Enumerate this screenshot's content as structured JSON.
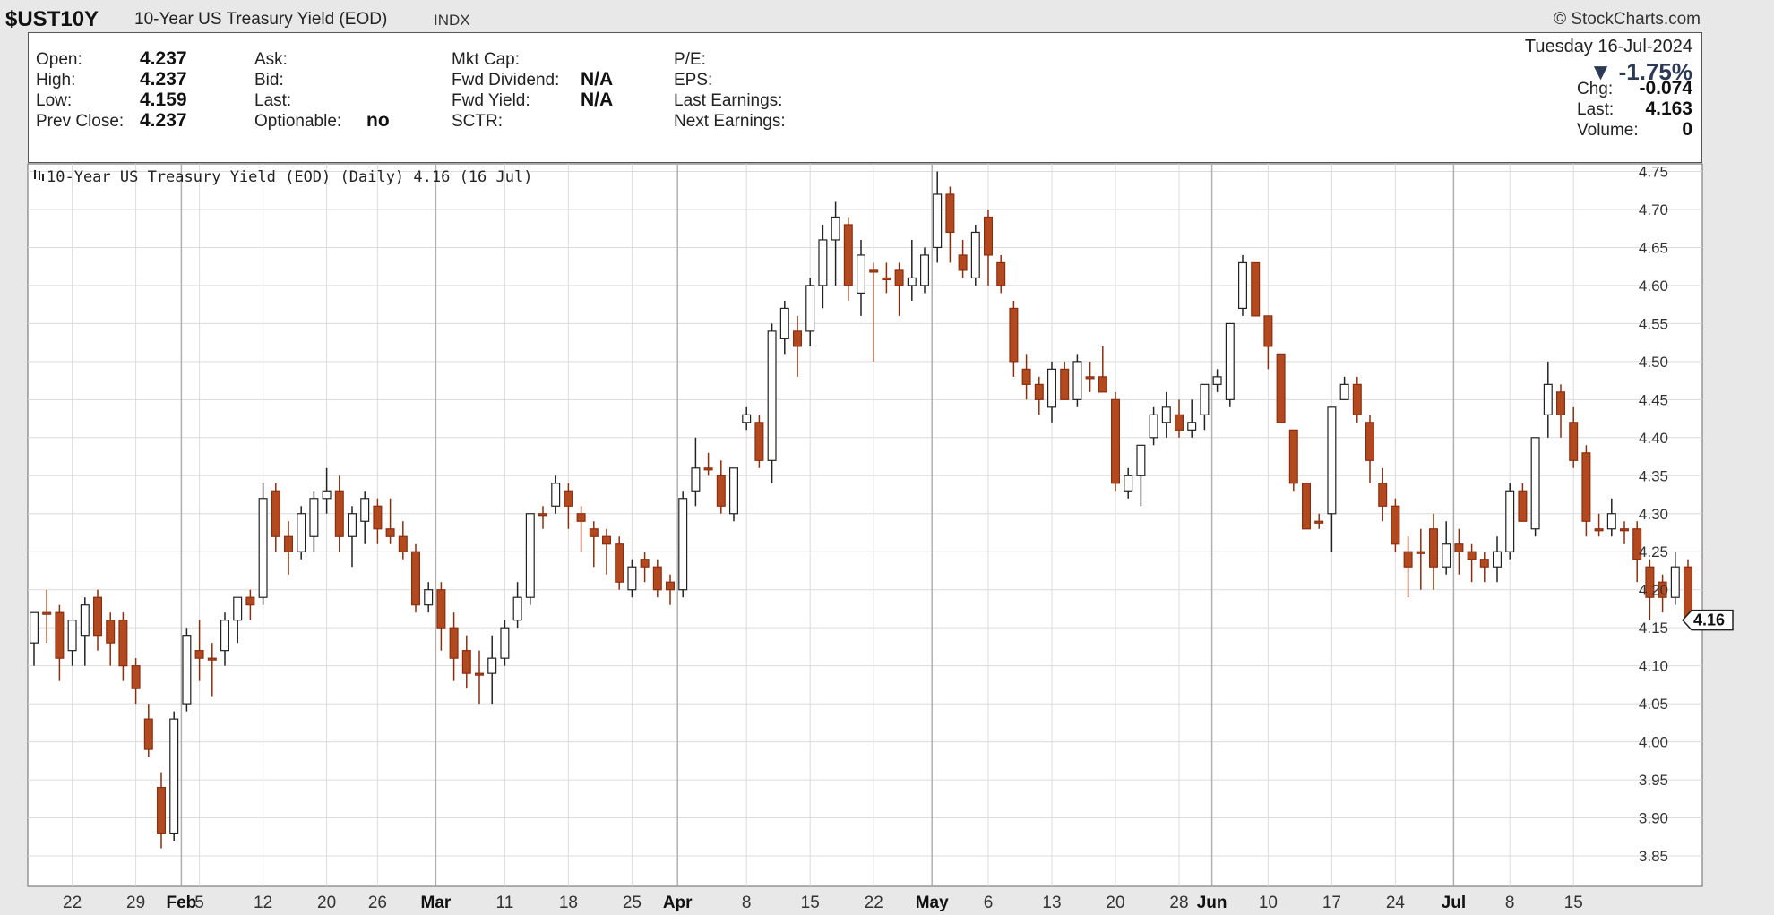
{
  "header": {
    "symbol": "$UST10Y",
    "name": "10-Year US Treasury Yield (EOD)",
    "index_tag": "INDX",
    "copyright": "© StockCharts.com"
  },
  "info": {
    "open_label": "Open:",
    "open": "4.237",
    "high_label": "High:",
    "high": "4.237",
    "low_label": "Low:",
    "low": "4.159",
    "prev_close_label": "Prev Close:",
    "prev_close": "4.237",
    "ask_label": "Ask:",
    "bid_label": "Bid:",
    "last_label": "Last:",
    "optionable_label": "Optionable:",
    "optionable": "no",
    "mkt_cap_label": "Mkt Cap:",
    "fwd_dividend_label": "Fwd Dividend:",
    "fwd_dividend": "N/A",
    "fwd_yield_label": "Fwd Yield:",
    "fwd_yield": "N/A",
    "sctr_label": "SCTR:",
    "pe_label": "P/E:",
    "eps_label": "EPS:",
    "last_earnings_label": "Last Earnings:",
    "next_earnings_label": "Next Earnings:",
    "date": "Tuesday  16-Jul-2024",
    "change_pct": "▼ -1.75%",
    "chg_label": "Chg:",
    "chg": "-0.074",
    "last_price_label": "Last:",
    "last_price": "4.163",
    "volume_label": "Volume:",
    "volume": "0"
  },
  "chart_data": {
    "type": "candlestick",
    "legend": "10-Year US Treasury Yield (EOD) (Daily) 4.16 (16 Jul)",
    "last_value_label": "4.16",
    "ylim": [
      3.81,
      4.76
    ],
    "yticks": [
      "4.75",
      "4.70",
      "4.65",
      "4.60",
      "4.55",
      "4.50",
      "4.45",
      "4.40",
      "4.35",
      "4.30",
      "4.25",
      "4.20",
      "4.15",
      "4.10",
      "4.05",
      "4.00",
      "3.95",
      "3.90",
      "3.85"
    ],
    "xticks": [
      {
        "label": "22",
        "bold": false
      },
      {
        "label": "29",
        "bold": false
      },
      {
        "label": "Feb",
        "bold": true
      },
      {
        "label": "5",
        "bold": false
      },
      {
        "label": "12",
        "bold": false
      },
      {
        "label": "20",
        "bold": false
      },
      {
        "label": "26",
        "bold": false
      },
      {
        "label": "Mar",
        "bold": true
      },
      {
        "label": "11",
        "bold": false
      },
      {
        "label": "18",
        "bold": false
      },
      {
        "label": "25",
        "bold": false
      },
      {
        "label": "Apr",
        "bold": true
      },
      {
        "label": "8",
        "bold": false
      },
      {
        "label": "15",
        "bold": false
      },
      {
        "label": "22",
        "bold": false
      },
      {
        "label": "May",
        "bold": true
      },
      {
        "label": "6",
        "bold": false
      },
      {
        "label": "13",
        "bold": false
      },
      {
        "label": "20",
        "bold": false
      },
      {
        "label": "28",
        "bold": false
      },
      {
        "label": "Jun",
        "bold": true
      },
      {
        "label": "10",
        "bold": false
      },
      {
        "label": "17",
        "bold": false
      },
      {
        "label": "24",
        "bold": false
      },
      {
        "label": "Jul",
        "bold": true
      },
      {
        "label": "8",
        "bold": false
      },
      {
        "label": "15",
        "bold": false
      }
    ],
    "candles": [
      [
        4.13,
        4.17,
        4.1,
        4.17
      ],
      [
        4.17,
        4.2,
        4.13,
        4.17
      ],
      [
        4.17,
        4.18,
        4.08,
        4.11
      ],
      [
        4.12,
        4.16,
        4.1,
        4.16
      ],
      [
        4.14,
        4.19,
        4.1,
        4.18
      ],
      [
        4.19,
        4.2,
        4.12,
        4.14
      ],
      [
        4.16,
        4.17,
        4.1,
        4.13
      ],
      [
        4.16,
        4.17,
        4.08,
        4.1
      ],
      [
        4.1,
        4.11,
        4.05,
        4.07
      ],
      [
        4.03,
        4.05,
        3.98,
        3.99
      ],
      [
        3.94,
        3.96,
        3.86,
        3.88
      ],
      [
        3.88,
        4.04,
        3.87,
        4.03
      ],
      [
        4.05,
        4.15,
        4.04,
        4.14
      ],
      [
        4.12,
        4.16,
        4.08,
        4.11
      ],
      [
        4.11,
        4.13,
        4.06,
        4.11
      ],
      [
        4.12,
        4.17,
        4.1,
        4.16
      ],
      [
        4.16,
        4.19,
        4.13,
        4.19
      ],
      [
        4.19,
        4.2,
        4.16,
        4.18
      ],
      [
        4.19,
        4.34,
        4.18,
        4.32
      ],
      [
        4.33,
        4.34,
        4.25,
        4.27
      ],
      [
        4.27,
        4.29,
        4.22,
        4.25
      ],
      [
        4.25,
        4.31,
        4.24,
        4.3
      ],
      [
        4.27,
        4.33,
        4.25,
        4.32
      ],
      [
        4.32,
        4.36,
        4.3,
        4.33
      ],
      [
        4.33,
        4.35,
        4.25,
        4.27
      ],
      [
        4.27,
        4.31,
        4.23,
        4.3
      ],
      [
        4.29,
        4.33,
        4.26,
        4.32
      ],
      [
        4.31,
        4.32,
        4.26,
        4.28
      ],
      [
        4.28,
        4.32,
        4.26,
        4.27
      ],
      [
        4.27,
        4.29,
        4.24,
        4.25
      ],
      [
        4.25,
        4.26,
        4.17,
        4.18
      ],
      [
        4.18,
        4.21,
        4.17,
        4.2
      ],
      [
        4.2,
        4.21,
        4.12,
        4.15
      ],
      [
        4.15,
        4.17,
        4.08,
        4.11
      ],
      [
        4.12,
        4.14,
        4.07,
        4.09
      ],
      [
        4.09,
        4.12,
        4.05,
        4.09
      ],
      [
        4.09,
        4.14,
        4.05,
        4.11
      ],
      [
        4.11,
        4.16,
        4.1,
        4.15
      ],
      [
        4.16,
        4.21,
        4.15,
        4.19
      ],
      [
        4.19,
        4.3,
        4.18,
        4.3
      ],
      [
        4.3,
        4.31,
        4.28,
        4.3
      ],
      [
        4.31,
        4.35,
        4.3,
        4.34
      ],
      [
        4.33,
        4.34,
        4.28,
        4.31
      ],
      [
        4.3,
        4.31,
        4.25,
        4.29
      ],
      [
        4.28,
        4.29,
        4.23,
        4.27
      ],
      [
        4.27,
        4.28,
        4.22,
        4.26
      ],
      [
        4.26,
        4.27,
        4.2,
        4.21
      ],
      [
        4.2,
        4.24,
        4.19,
        4.23
      ],
      [
        4.24,
        4.25,
        4.21,
        4.23
      ],
      [
        4.23,
        4.24,
        4.19,
        4.2
      ],
      [
        4.21,
        4.22,
        4.18,
        4.2
      ],
      [
        4.2,
        4.33,
        4.19,
        4.32
      ],
      [
        4.33,
        4.4,
        4.31,
        4.36
      ],
      [
        4.36,
        4.38,
        4.35,
        4.36
      ],
      [
        4.35,
        4.37,
        4.3,
        4.31
      ],
      [
        4.3,
        4.36,
        4.29,
        4.36
      ],
      [
        4.42,
        4.44,
        4.41,
        4.43
      ],
      [
        4.42,
        4.43,
        4.36,
        4.37
      ],
      [
        4.37,
        4.55,
        4.34,
        4.54
      ],
      [
        4.53,
        4.58,
        4.51,
        4.57
      ],
      [
        4.54,
        4.56,
        4.48,
        4.52
      ],
      [
        4.54,
        4.61,
        4.52,
        4.6
      ],
      [
        4.6,
        4.68,
        4.57,
        4.66
      ],
      [
        4.66,
        4.71,
        4.6,
        4.69
      ],
      [
        4.68,
        4.69,
        4.58,
        4.6
      ],
      [
        4.59,
        4.66,
        4.56,
        4.64
      ],
      [
        4.62,
        4.63,
        4.5,
        4.62
      ],
      [
        4.61,
        4.63,
        4.59,
        4.61
      ],
      [
        4.62,
        4.63,
        4.56,
        4.6
      ],
      [
        4.6,
        4.66,
        4.58,
        4.61
      ],
      [
        4.6,
        4.65,
        4.59,
        4.64
      ],
      [
        4.65,
        4.75,
        4.63,
        4.72
      ],
      [
        4.72,
        4.73,
        4.63,
        4.67
      ],
      [
        4.64,
        4.66,
        4.61,
        4.62
      ],
      [
        4.61,
        4.68,
        4.6,
        4.67
      ],
      [
        4.69,
        4.7,
        4.6,
        4.64
      ],
      [
        4.63,
        4.64,
        4.59,
        4.6
      ],
      [
        4.57,
        4.58,
        4.48,
        4.5
      ],
      [
        4.49,
        4.51,
        4.45,
        4.47
      ],
      [
        4.47,
        4.48,
        4.43,
        4.45
      ],
      [
        4.44,
        4.5,
        4.42,
        4.49
      ],
      [
        4.49,
        4.5,
        4.45,
        4.45
      ],
      [
        4.45,
        4.51,
        4.44,
        4.5
      ],
      [
        4.48,
        4.5,
        4.46,
        4.48
      ],
      [
        4.48,
        4.52,
        4.46,
        4.46
      ],
      [
        4.45,
        4.46,
        4.33,
        4.34
      ],
      [
        4.33,
        4.36,
        4.32,
        4.35
      ],
      [
        4.35,
        4.39,
        4.31,
        4.39
      ],
      [
        4.4,
        4.44,
        4.39,
        4.43
      ],
      [
        4.42,
        4.46,
        4.4,
        4.44
      ],
      [
        4.43,
        4.45,
        4.4,
        4.41
      ],
      [
        4.41,
        4.45,
        4.4,
        4.42
      ],
      [
        4.43,
        4.47,
        4.41,
        4.47
      ],
      [
        4.47,
        4.49,
        4.46,
        4.48
      ],
      [
        4.45,
        4.55,
        4.44,
        4.55
      ],
      [
        4.57,
        4.64,
        4.56,
        4.63
      ],
      [
        4.63,
        4.63,
        4.57,
        4.56
      ],
      [
        4.56,
        4.56,
        4.49,
        4.52
      ],
      [
        4.51,
        4.51,
        4.42,
        4.42
      ],
      [
        4.41,
        4.41,
        4.33,
        4.34
      ],
      [
        4.34,
        4.34,
        4.28,
        4.28
      ],
      [
        4.29,
        4.3,
        4.28,
        4.29
      ],
      [
        4.3,
        4.44,
        4.25,
        4.44
      ],
      [
        4.45,
        4.48,
        4.46,
        4.47
      ],
      [
        4.47,
        4.48,
        4.42,
        4.43
      ],
      [
        4.42,
        4.43,
        4.34,
        4.37
      ],
      [
        4.34,
        4.36,
        4.29,
        4.31
      ],
      [
        4.31,
        4.32,
        4.25,
        4.26
      ],
      [
        4.25,
        4.27,
        4.19,
        4.23
      ],
      [
        4.25,
        4.28,
        4.2,
        4.25
      ],
      [
        4.28,
        4.3,
        4.2,
        4.23
      ],
      [
        4.23,
        4.29,
        4.22,
        4.26
      ],
      [
        4.26,
        4.28,
        4.22,
        4.25
      ],
      [
        4.25,
        4.26,
        4.21,
        4.24
      ],
      [
        4.24,
        4.25,
        4.21,
        4.23
      ],
      [
        4.23,
        4.27,
        4.21,
        4.25
      ],
      [
        4.25,
        4.34,
        4.24,
        4.33
      ],
      [
        4.33,
        4.34,
        4.29,
        4.29
      ],
      [
        4.28,
        4.4,
        4.27,
        4.4
      ],
      [
        4.43,
        4.5,
        4.4,
        4.47
      ],
      [
        4.46,
        4.47,
        4.4,
        4.43
      ],
      [
        4.42,
        4.44,
        4.36,
        4.37
      ],
      [
        4.38,
        4.39,
        4.27,
        4.29
      ],
      [
        4.28,
        4.3,
        4.27,
        4.28
      ],
      [
        4.28,
        4.32,
        4.27,
        4.3
      ],
      [
        4.28,
        4.29,
        4.26,
        4.28
      ],
      [
        4.28,
        4.29,
        4.21,
        4.24
      ],
      [
        4.23,
        4.24,
        4.16,
        4.19
      ],
      [
        4.21,
        4.22,
        4.17,
        4.19
      ],
      [
        4.19,
        4.25,
        4.18,
        4.23
      ],
      [
        4.23,
        4.24,
        4.16,
        4.16
      ]
    ]
  }
}
